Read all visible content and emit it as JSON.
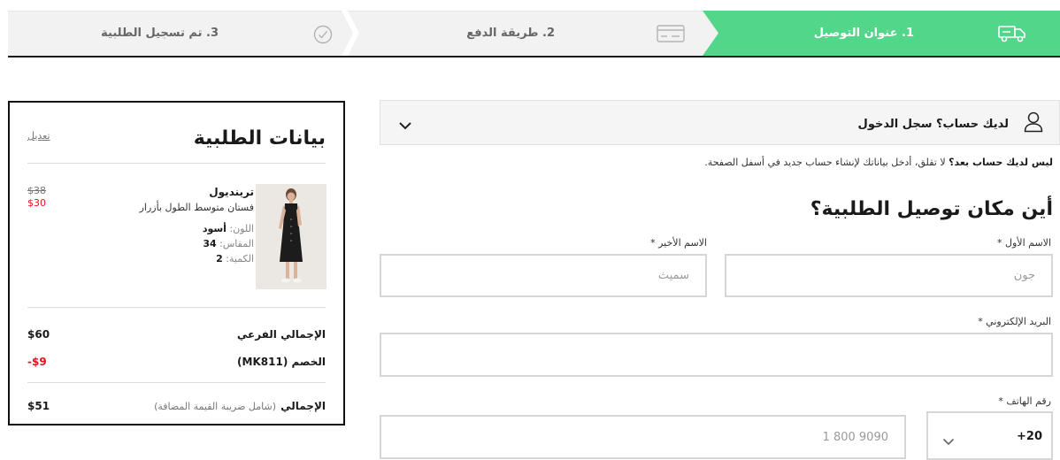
{
  "steps": [
    {
      "label": "1. عنوان التوصيل",
      "icon": "truck-icon",
      "active": true
    },
    {
      "label": "2. طريقة الدفع",
      "icon": "credit-card-icon",
      "active": false
    },
    {
      "label": "3. تم تسجيل الطلبية",
      "icon": "check-circle-icon",
      "active": false
    }
  ],
  "login": {
    "text": "لديك حساب؟ سجل الدخول",
    "user_icon": "user-icon",
    "toggle_icon": "chevron-down-icon"
  },
  "note": {
    "bold": "ليس لديك حساب بعد؟",
    "text": " لا تقلق، أدخل بياناتك لإنشاء حساب جديد في أسفل الصفحة."
  },
  "form": {
    "title": "أين مكان توصيل الطلبية؟",
    "first_name": {
      "label": "الاسم الأول *",
      "placeholder": "جون"
    },
    "last_name": {
      "label": "الاسم الأخير *",
      "placeholder": "سميث"
    },
    "email": {
      "label": "البريد الإلكتروني *",
      "placeholder": ""
    },
    "phone": {
      "label": "رقم الهاتف *",
      "country_code": "+20",
      "placeholder": "1 800 9090"
    }
  },
  "summary": {
    "title": "بيانات الطلبية",
    "edit": "تعديل",
    "item": {
      "brand": "ترينديول",
      "name": "فستان متوسط الطول بأزرار",
      "color_label": "اللون:",
      "color": "أسود",
      "size_label": "المقاس:",
      "size": "34",
      "qty_label": "الكمية:",
      "qty": "2",
      "price_old": "$38",
      "price_new": "$30"
    },
    "subtotal_label": "الإجمالي الفرعي",
    "subtotal": "$60",
    "discount_label": "الخصم (MK811)",
    "discount": "-$9",
    "total_label": "الإجمالي",
    "total_note": "(شامل ضريبة القيمة المضافة)",
    "total": "$51"
  },
  "colors": {
    "accent": "#52d68a",
    "sale": "#e0131a"
  }
}
